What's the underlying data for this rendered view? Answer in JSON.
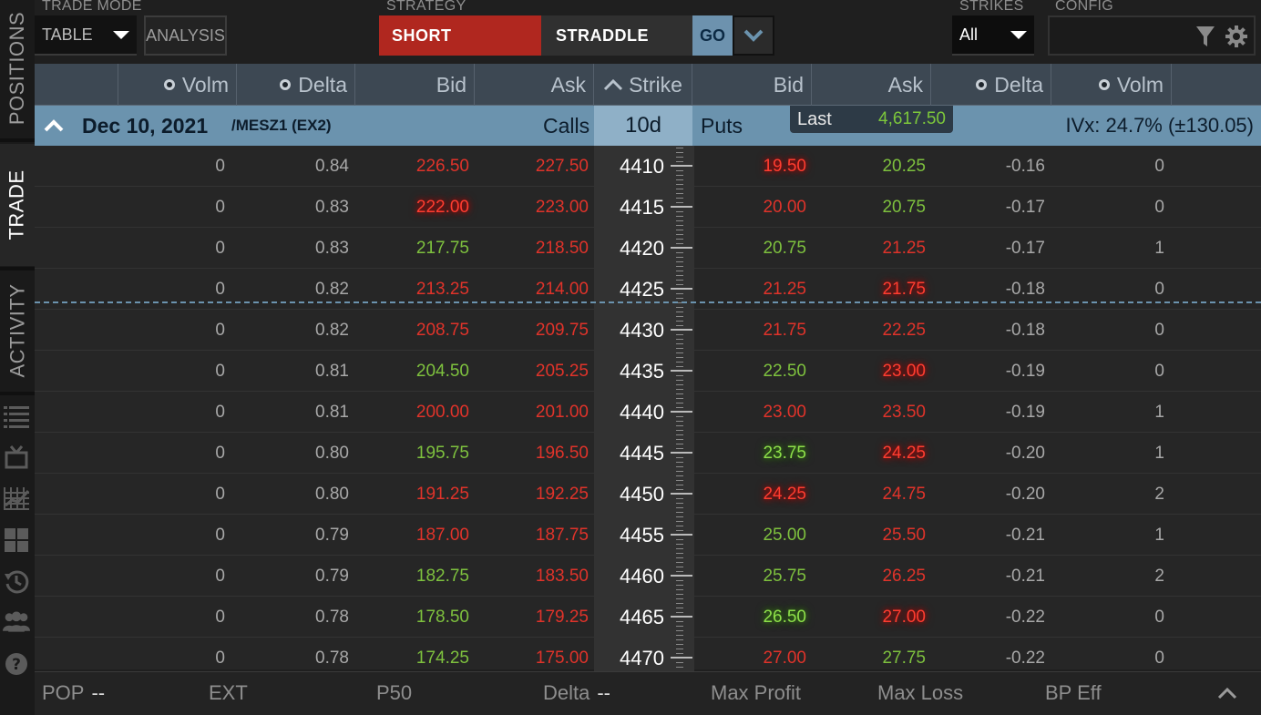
{
  "rail": {
    "tabs": [
      "POSITIONS",
      "TRADE",
      "ACTIVITY"
    ],
    "icons": [
      "list-icon",
      "tv-icon",
      "chart-icon",
      "grid-icon",
      "history-icon",
      "people-icon",
      "help-icon"
    ]
  },
  "toolbar": {
    "trade_mode_label": "TRADE MODE",
    "trade_mode_value": "TABLE",
    "analysis_label": "ANALYSIS",
    "strategy_label": "STRATEGY",
    "side": "SHORT",
    "strategy": "STRADDLE",
    "go_label": "GO",
    "strikes_label": "STRIKES",
    "strikes_value": "All",
    "config_label": "CONFIG"
  },
  "headers": {
    "call_volm": "Volm",
    "call_delta": "Delta",
    "call_bid": "Bid",
    "call_ask": "Ask",
    "strike": "Strike",
    "put_bid": "Bid",
    "put_ask": "Ask",
    "put_delta": "Delta",
    "put_volm": "Volm"
  },
  "expiry": {
    "date": "Dec 10, 2021",
    "symbol": "/MESZ1 (EX2)",
    "calls_label": "Calls",
    "dte": "10d",
    "puts_label": "Puts",
    "last_label": "Last",
    "last_value": "4,617.50",
    "ivx": "IVx: 24.7% (±130.05)"
  },
  "rows": [
    {
      "strike": "4410",
      "c_volm": "0",
      "c_delta": "0.84",
      "c_bid": "226.50",
      "c_ask": "227.50",
      "p_bid": "19.50",
      "p_ask": "20.25",
      "p_delta": "-0.16",
      "p_volm": "0",
      "cb": "r",
      "ca": "r",
      "pb": "glow-r",
      "pa": "g"
    },
    {
      "strike": "4415",
      "c_volm": "0",
      "c_delta": "0.83",
      "c_bid": "222.00",
      "c_ask": "223.00",
      "p_bid": "20.00",
      "p_ask": "20.75",
      "p_delta": "-0.17",
      "p_volm": "0",
      "cb": "glow-r",
      "ca": "r",
      "pb": "r",
      "pa": "g"
    },
    {
      "strike": "4420",
      "c_volm": "0",
      "c_delta": "0.83",
      "c_bid": "217.75",
      "c_ask": "218.50",
      "p_bid": "20.75",
      "p_ask": "21.25",
      "p_delta": "-0.17",
      "p_volm": "1",
      "cb": "g",
      "ca": "r",
      "pb": "g",
      "pa": "r"
    },
    {
      "strike": "4425",
      "c_volm": "0",
      "c_delta": "0.82",
      "c_bid": "213.25",
      "c_ask": "214.00",
      "p_bid": "21.25",
      "p_ask": "21.75",
      "p_delta": "-0.18",
      "p_volm": "0",
      "cb": "r",
      "ca": "r",
      "pb": "r",
      "pa": "glow-r"
    },
    {
      "strike": "4430",
      "c_volm": "0",
      "c_delta": "0.82",
      "c_bid": "208.75",
      "c_ask": "209.75",
      "p_bid": "21.75",
      "p_ask": "22.25",
      "p_delta": "-0.18",
      "p_volm": "0",
      "cb": "r",
      "ca": "r",
      "pb": "r",
      "pa": "r"
    },
    {
      "strike": "4435",
      "c_volm": "0",
      "c_delta": "0.81",
      "c_bid": "204.50",
      "c_ask": "205.25",
      "p_bid": "22.50",
      "p_ask": "23.00",
      "p_delta": "-0.19",
      "p_volm": "0",
      "cb": "g",
      "ca": "r",
      "pb": "g",
      "pa": "glow-r"
    },
    {
      "strike": "4440",
      "c_volm": "0",
      "c_delta": "0.81",
      "c_bid": "200.00",
      "c_ask": "201.00",
      "p_bid": "23.00",
      "p_ask": "23.50",
      "p_delta": "-0.19",
      "p_volm": "1",
      "cb": "r",
      "ca": "r",
      "pb": "r",
      "pa": "r"
    },
    {
      "strike": "4445",
      "c_volm": "0",
      "c_delta": "0.80",
      "c_bid": "195.75",
      "c_ask": "196.50",
      "p_bid": "23.75",
      "p_ask": "24.25",
      "p_delta": "-0.20",
      "p_volm": "1",
      "cb": "g",
      "ca": "r",
      "pb": "glow-g",
      "pa": "glow-r"
    },
    {
      "strike": "4450",
      "c_volm": "0",
      "c_delta": "0.80",
      "c_bid": "191.25",
      "c_ask": "192.25",
      "p_bid": "24.25",
      "p_ask": "24.75",
      "p_delta": "-0.20",
      "p_volm": "2",
      "cb": "r",
      "ca": "r",
      "pb": "glow-r",
      "pa": "r"
    },
    {
      "strike": "4455",
      "c_volm": "0",
      "c_delta": "0.79",
      "c_bid": "187.00",
      "c_ask": "187.75",
      "p_bid": "25.00",
      "p_ask": "25.50",
      "p_delta": "-0.21",
      "p_volm": "1",
      "cb": "r",
      "ca": "r",
      "pb": "g",
      "pa": "r"
    },
    {
      "strike": "4460",
      "c_volm": "0",
      "c_delta": "0.79",
      "c_bid": "182.75",
      "c_ask": "183.50",
      "p_bid": "25.75",
      "p_ask": "26.25",
      "p_delta": "-0.21",
      "p_volm": "2",
      "cb": "g",
      "ca": "r",
      "pb": "g",
      "pa": "r"
    },
    {
      "strike": "4465",
      "c_volm": "0",
      "c_delta": "0.78",
      "c_bid": "178.50",
      "c_ask": "179.25",
      "p_bid": "26.50",
      "p_ask": "27.00",
      "p_delta": "-0.22",
      "p_volm": "0",
      "cb": "g",
      "ca": "r",
      "pb": "glow-g",
      "pa": "glow-r"
    },
    {
      "strike": "4470",
      "c_volm": "0",
      "c_delta": "0.78",
      "c_bid": "174.25",
      "c_ask": "175.00",
      "p_bid": "27.00",
      "p_ask": "27.75",
      "p_delta": "-0.22",
      "p_volm": "0",
      "cb": "g",
      "ca": "r",
      "pb": "r",
      "pa": "g"
    }
  ],
  "summary": {
    "pop_label": "POP",
    "pop_value": "--",
    "ext_label": "EXT",
    "p50_label": "P50",
    "delta_label": "Delta",
    "delta_value": "--",
    "max_profit_label": "Max Profit",
    "max_loss_label": "Max Loss",
    "bp_eff_label": "BP Eff"
  },
  "colors": {
    "short": "#b0271f",
    "accent": "#6b93ae",
    "green": "#7ec13e",
    "red": "#e0332a"
  }
}
